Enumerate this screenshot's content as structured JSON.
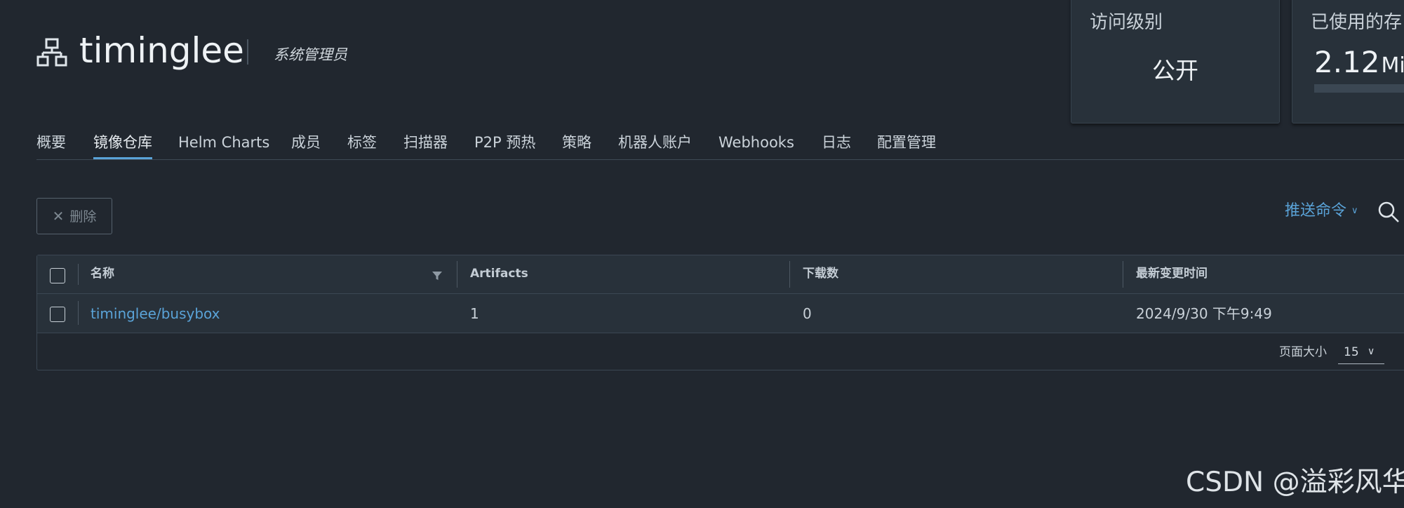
{
  "header": {
    "project_name": "timinglee",
    "role": "系统管理员",
    "icon": "project-icon"
  },
  "cards": {
    "access": {
      "title": "访问级别",
      "value": "公开"
    },
    "storage": {
      "title": "已使用的存",
      "value": "2.12",
      "unit": "MiB"
    }
  },
  "tabs": [
    {
      "label": "概要",
      "active": false
    },
    {
      "label": "镜像仓库",
      "active": true
    },
    {
      "label": "Helm Charts",
      "active": false
    },
    {
      "label": "成员",
      "active": false
    },
    {
      "label": "标签",
      "active": false
    },
    {
      "label": "扫描器",
      "active": false
    },
    {
      "label": "P2P 预热",
      "active": false
    },
    {
      "label": "策略",
      "active": false
    },
    {
      "label": "机器人账户",
      "active": false
    },
    {
      "label": "Webhooks",
      "active": false
    },
    {
      "label": "日志",
      "active": false
    },
    {
      "label": "配置管理",
      "active": false
    }
  ],
  "toolbar": {
    "delete_label": "删除",
    "delete_icon": "close-icon",
    "push_command_label": "推送命令",
    "search_icon": "search-icon"
  },
  "table": {
    "columns": [
      "名称",
      "Artifacts",
      "下载数",
      "最新变更时间"
    ],
    "rows": [
      {
        "name": "timinglee/busybox",
        "artifacts": "1",
        "downloads": "0",
        "updated": "2024/9/30 下午9:49"
      }
    ],
    "footer": {
      "page_size_label": "页面大小",
      "page_size": "15"
    }
  },
  "watermark": "CSDN @溢彩风华",
  "colors": {
    "background": "#21272f",
    "panel": "#28313a",
    "accent": "#5aa3d8",
    "text": "#d4dbe2"
  }
}
